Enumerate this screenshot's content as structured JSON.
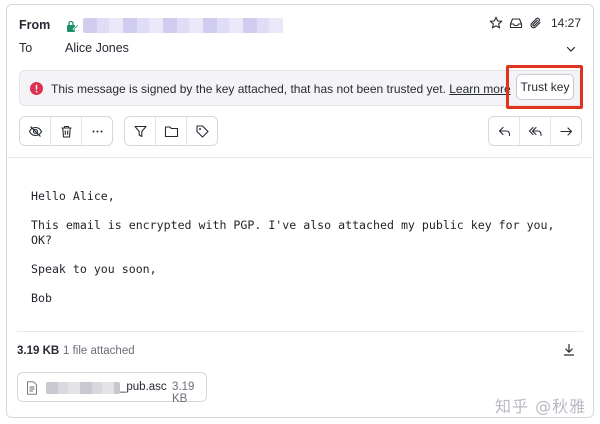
{
  "header": {
    "from_label": "From",
    "to_label": "To",
    "recipient": "Alice Jones",
    "time": "14:27",
    "icons": [
      "lock-pencil-icon",
      "star-icon",
      "inbox-icon",
      "paperclip-icon",
      "chevron-down-icon"
    ]
  },
  "banner": {
    "message": "This message is signed by the key attached, that has not been trusted yet.",
    "learn_more": "Learn more",
    "trust_key": "Trust key",
    "status_color": "#dc3251",
    "highlight_color": "#e0321e"
  },
  "toolbar": {
    "group1": [
      "eye-off-icon",
      "trash-icon",
      "more-icon"
    ],
    "group2": [
      "filter-icon",
      "folder-icon",
      "tag-icon"
    ],
    "group3": [
      "reply-icon",
      "reply-all-icon",
      "forward-icon"
    ]
  },
  "message": {
    "greeting": "Hello Alice,",
    "paragraph": "This email is encrypted with PGP. I've also attached my public key for you,\nOK?",
    "closing": "Speak to you soon,",
    "signature": "Bob"
  },
  "attachments": {
    "total_size": "3.19 KB",
    "count_text": "1 file attached",
    "files": [
      {
        "name_suffix": "_pub.asc",
        "size": "3.19 KB"
      }
    ]
  },
  "watermark": "知乎 @秋雅"
}
